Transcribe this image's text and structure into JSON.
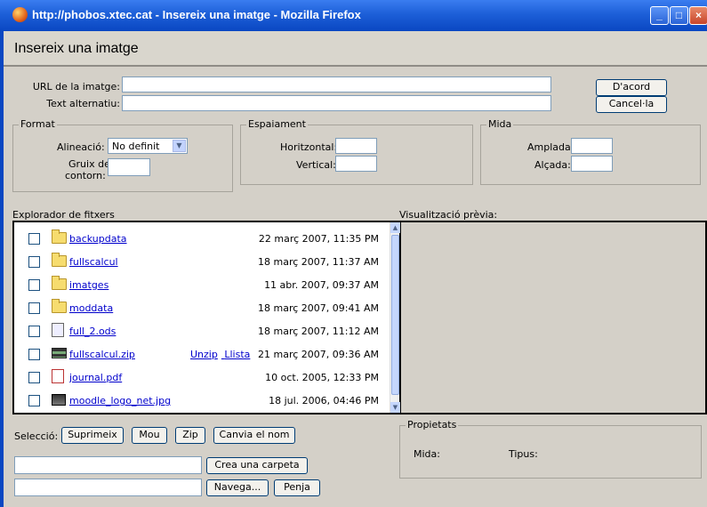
{
  "window": {
    "title": "http://phobos.xtec.cat - Insereix una imatge - Mozilla Firefox"
  },
  "dialog": {
    "title": "Insereix una imatge"
  },
  "form": {
    "url_label": "URL de la imatge:",
    "url_value": "",
    "alt_label": "Text alternatiu:",
    "alt_value": "",
    "ok_label": "D'acord",
    "cancel_label": "Cancel·la"
  },
  "format": {
    "legend": "Format",
    "align_label": "Alineació:",
    "align_value": "No definit",
    "border_label_1": "Gruix del",
    "border_label_2": "contorn:"
  },
  "spacing": {
    "legend": "Espaiament",
    "h_label": "Horitzontal:",
    "v_label": "Vertical:"
  },
  "size": {
    "legend": "Mida",
    "width_label": "Amplada:",
    "height_label": "Alçada:"
  },
  "explorer": {
    "label": "Explorador de fitxers",
    "preview_label": "Visualització prèvia:",
    "files": [
      {
        "name": "backupdata",
        "type": "folder",
        "date": "22 març 2007, 11:35 PM",
        "actions": []
      },
      {
        "name": "fullscalcul",
        "type": "folder",
        "date": "18 març 2007, 11:37 AM",
        "actions": []
      },
      {
        "name": "imatges",
        "type": "folder",
        "date": "11 abr. 2007, 09:37 AM",
        "actions": []
      },
      {
        "name": "moddata",
        "type": "folder",
        "date": "18 març 2007, 09:41 AM",
        "actions": []
      },
      {
        "name": "full_2.ods",
        "type": "doc",
        "date": "18 març 2007, 11:12 AM",
        "actions": []
      },
      {
        "name": "fullscalcul.zip",
        "type": "zip",
        "date": "21 març 2007, 09:36 AM",
        "actions": [
          "Unzip",
          "Llista"
        ]
      },
      {
        "name": "journal.pdf",
        "type": "pdf",
        "date": "10 oct. 2005, 12:33 PM",
        "actions": []
      },
      {
        "name": "moodle_logo_net.jpg",
        "type": "img",
        "date": "18 jul. 2006, 04:46 PM",
        "actions": []
      }
    ]
  },
  "selection": {
    "label": "Selecció:",
    "delete_label": "Suprimeix",
    "move_label": "Mou",
    "zip_label": "Zip",
    "rename_label": "Canvia el nom"
  },
  "folder_create": {
    "button_label": "Crea una carpeta",
    "value": ""
  },
  "upload": {
    "browse_label": "Navega...",
    "upload_label": "Penja",
    "value": ""
  },
  "properties": {
    "legend": "Propietats",
    "size_label": "Mida:",
    "type_label": "Tipus:"
  }
}
